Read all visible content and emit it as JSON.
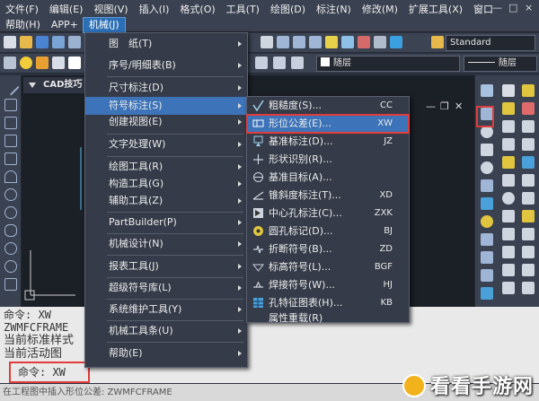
{
  "menubar": {
    "row1": [
      "文件(F)",
      "编辑(E)",
      "视图(V)",
      "插入(I)",
      "格式(O)",
      "工具(T)",
      "绘图(D)",
      "标注(N)",
      "修改(M)",
      "扩展工具(X)",
      "窗口"
    ],
    "row2": [
      "帮助(H)",
      "APP+",
      "机械(J)"
    ],
    "window_controls": [
      "—",
      "□",
      "×"
    ]
  },
  "toolbar": {
    "text_style": "Standard",
    "layer1": "随层",
    "layer2": "随层"
  },
  "document_tab": "CAD技巧",
  "mech_menu": {
    "items": [
      {
        "label": "图　纸(T)",
        "sub": true
      },
      {
        "label": "序号/明细表(B)",
        "sub": true
      },
      {
        "label": "尺寸标注(D)",
        "sub": true
      },
      {
        "label": "符号标注(S)",
        "sub": true,
        "active": true
      },
      {
        "label": "创建视图(E)",
        "sub": true
      },
      {
        "label": "文字处理(W)",
        "sub": true
      },
      {
        "label": "绘图工具(R)",
        "sub": true
      },
      {
        "label": "构造工具(G)",
        "sub": true
      },
      {
        "label": "辅助工具(Z)",
        "sub": true
      },
      {
        "label": "PartBuilder(P)",
        "sub": true
      },
      {
        "label": "机械设计(N)",
        "sub": true
      },
      {
        "label": "报表工具(J)",
        "sub": true
      },
      {
        "label": "超级符号库(L)",
        "sub": true
      },
      {
        "label": "系统维护工具(Y)",
        "sub": true
      },
      {
        "label": "机械工具条(U)",
        "sub": true
      },
      {
        "label": "帮助(E)",
        "sub": true
      }
    ]
  },
  "symbol_menu": {
    "items": [
      {
        "label": "粗糙度(S)...",
        "shortcut": "CC",
        "icon": "roughness-icon"
      },
      {
        "label": "形位公差(E)...",
        "shortcut": "XW",
        "icon": "tolerance-frame-icon",
        "highlight": true
      },
      {
        "label": "基准标注(D)...",
        "shortcut": "JZ",
        "icon": "datum-icon"
      },
      {
        "label": "形状识别(R)...",
        "shortcut": "",
        "icon": "shape-recognition-icon"
      },
      {
        "label": "基准目标(A)...",
        "shortcut": "",
        "icon": "datum-target-icon"
      },
      {
        "label": "锥斜度标注(T)...",
        "shortcut": "XD",
        "icon": "taper-icon"
      },
      {
        "label": "中心孔标注(C)...",
        "shortcut": "ZXK",
        "icon": "center-hole-icon"
      },
      {
        "label": "圆孔标记(D)...",
        "shortcut": "BJ",
        "icon": "hole-mark-icon"
      },
      {
        "label": "折断符号(B)...",
        "shortcut": "ZD",
        "icon": "break-symbol-icon"
      },
      {
        "label": "标高符号(L)...",
        "shortcut": "BGF",
        "icon": "elevation-icon"
      },
      {
        "label": "焊接符号(W)...",
        "shortcut": "HJ",
        "icon": "weld-icon"
      },
      {
        "label": "孔特征图表(H)...",
        "shortcut": "KB",
        "icon": "hole-table-icon"
      },
      {
        "label": "属性重载(R)",
        "shortcut": "",
        "icon": ""
      }
    ]
  },
  "command": {
    "lines": [
      "命令: XW",
      "ZWMFCFRAME",
      "当前标准样式",
      "当前活动图"
    ],
    "prompt": "命令: XW"
  },
  "status": "在工程图中插入形位公差: ZWMFCFRAME",
  "watermark": "看看手游网"
}
